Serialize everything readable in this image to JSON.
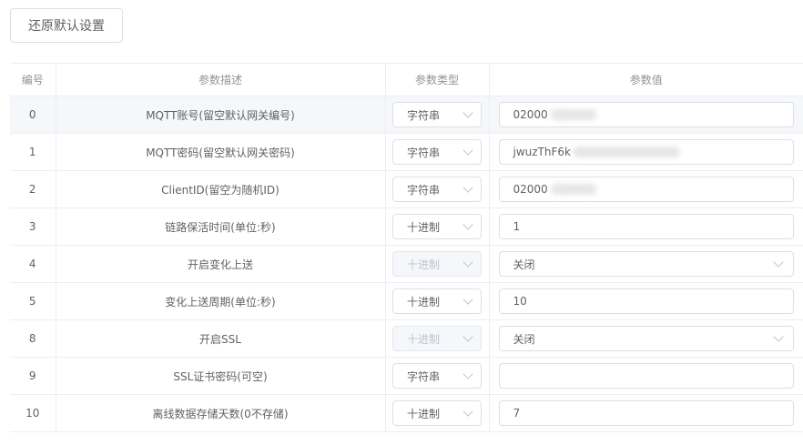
{
  "toolbar": {
    "reset_label": "还原默认设置"
  },
  "table": {
    "headers": {
      "index": "编号",
      "description": "参数描述",
      "type": "参数类型",
      "value": "参数值"
    },
    "rows": [
      {
        "index": "0",
        "description": "MQTT账号(留空默认网关编号)",
        "type": "字符串",
        "type_disabled": false,
        "value": "02000",
        "value_kind": "input",
        "redacted": true
      },
      {
        "index": "1",
        "description": "MQTT密码(留空默认网关密码)",
        "type": "字符串",
        "type_disabled": false,
        "value": "jwuzThF6k",
        "value_kind": "input",
        "redacted": true
      },
      {
        "index": "2",
        "description": "ClientID(留空为随机ID)",
        "type": "字符串",
        "type_disabled": false,
        "value": "02000",
        "value_kind": "input",
        "redacted": true
      },
      {
        "index": "3",
        "description": "链路保活时间(单位:秒)",
        "type": "十进制",
        "type_disabled": false,
        "value": "1",
        "value_kind": "input",
        "redacted": false
      },
      {
        "index": "4",
        "description": "开启变化上送",
        "type": "十进制",
        "type_disabled": true,
        "value": "关闭",
        "value_kind": "select",
        "redacted": false
      },
      {
        "index": "5",
        "description": "变化上送周期(单位:秒)",
        "type": "十进制",
        "type_disabled": false,
        "value": "10",
        "value_kind": "input",
        "redacted": false
      },
      {
        "index": "8",
        "description": "开启SSL",
        "type": "十进制",
        "type_disabled": true,
        "value": "关闭",
        "value_kind": "select",
        "redacted": false
      },
      {
        "index": "9",
        "description": "SSL证书密码(可空)",
        "type": "字符串",
        "type_disabled": false,
        "value": "",
        "value_kind": "input",
        "redacted": false
      },
      {
        "index": "10",
        "description": "离线数据存储天数(0不存储)",
        "type": "十进制",
        "type_disabled": false,
        "value": "7",
        "value_kind": "input",
        "redacted": false
      }
    ]
  },
  "icons": {
    "dropdown": "chevron-down-icon"
  }
}
